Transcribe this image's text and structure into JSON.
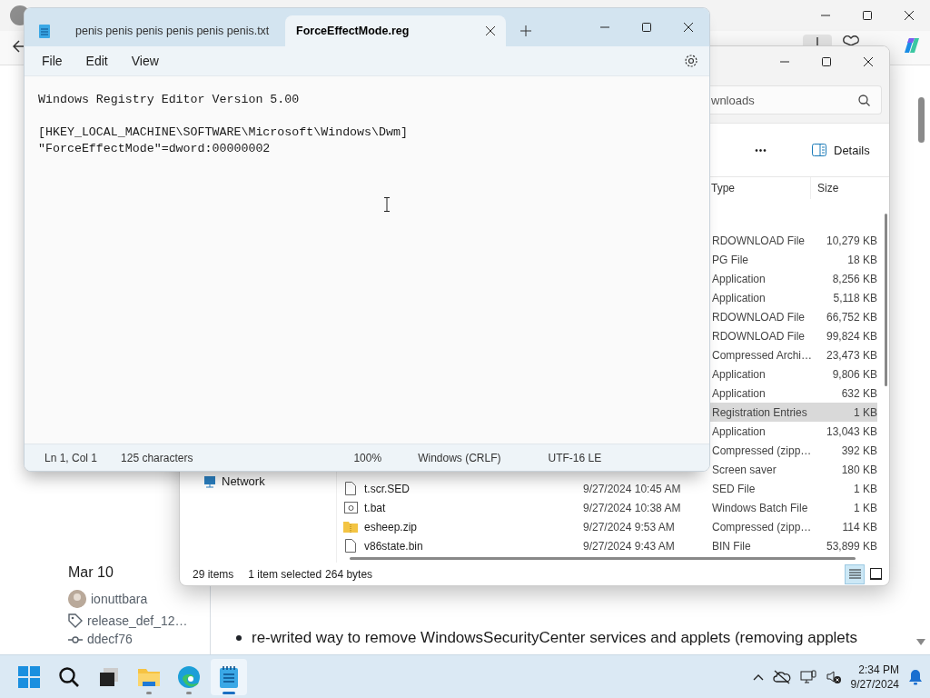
{
  "browser": {
    "page": {
      "date": "Mar 10",
      "author": "ionuttbara",
      "tag": "release_def_12…",
      "commit": "ddecf76",
      "bullets": [
        "re-writed way to remove WindowsSecurityCenter services and applets (removing applets"
      ]
    }
  },
  "explorer": {
    "search": {
      "placeholder": "wnloads"
    },
    "toolbar": {
      "more": "•••",
      "view_button": "Details"
    },
    "columns": [
      "Type",
      "Size"
    ],
    "rows": [
      {
        "type": "RDOWNLOAD File",
        "size": "10,279 KB",
        "selected": false
      },
      {
        "type": "PG File",
        "size": "18 KB",
        "selected": false
      },
      {
        "type": "Application",
        "size": "8,256 KB",
        "selected": false
      },
      {
        "type": "Application",
        "size": "5,118 KB",
        "selected": false
      },
      {
        "type": "RDOWNLOAD File",
        "size": "66,752 KB",
        "selected": false
      },
      {
        "type": "RDOWNLOAD File",
        "size": "99,824 KB",
        "selected": false
      },
      {
        "type": "Compressed Archi…",
        "size": "23,473 KB",
        "selected": false
      },
      {
        "type": "Application",
        "size": "9,806 KB",
        "selected": false
      },
      {
        "type": "Application",
        "size": "632 KB",
        "selected": false
      },
      {
        "type": "Registration Entries",
        "size": "1 KB",
        "selected": true
      },
      {
        "type": "Application",
        "size": "13,043 KB",
        "selected": false
      },
      {
        "type": "Compressed (zipp…",
        "size": "392 KB",
        "selected": false
      },
      {
        "type": "Screen saver",
        "size": "180 KB",
        "selected": false
      },
      {
        "kind": "file",
        "name": "t.scr.SED",
        "date": "9/27/2024 10:45 AM",
        "type": "SED File",
        "size": "1 KB",
        "selected": false
      },
      {
        "kind": "batch",
        "name": "t.bat",
        "date": "9/27/2024 10:38 AM",
        "type": "Windows Batch File",
        "size": "1 KB",
        "selected": false
      },
      {
        "kind": "zip",
        "name": "esheep.zip",
        "date": "9/27/2024 9:53 AM",
        "type": "Compressed (zipp…",
        "size": "114 KB",
        "selected": false
      },
      {
        "kind": "file",
        "name": "v86state.bin",
        "date": "9/27/2024 9:43 AM",
        "type": "BIN File",
        "size": "53,899 KB",
        "selected": false
      }
    ],
    "nav": [
      "Network"
    ],
    "status": {
      "items": "29 items",
      "selection": "1 item selected",
      "size": "264 bytes"
    },
    "view_modes": [
      {
        "kind": "details",
        "selected": true
      },
      {
        "kind": "tiles",
        "selected": false
      }
    ]
  },
  "notepad": {
    "tabs": [
      {
        "label": "penis penis penis penis penis penis.txt",
        "selected": false
      },
      {
        "label": "ForceEffectMode.reg",
        "selected": true
      }
    ],
    "menu": [
      "File",
      "Edit",
      "View"
    ],
    "blocks": [
      [
        "Windows Registry Editor Version 5.00"
      ],
      [
        "[HKEY_LOCAL_MACHINE\\SOFTWARE\\Microsoft\\Windows\\Dwm]",
        "\"ForceEffectMode\"=dword:00000002"
      ]
    ],
    "status": {
      "position": "Ln 1, Col 1",
      "count": "125 characters",
      "zoom": "100%",
      "line_ending": "Windows (CRLF)",
      "encoding": "UTF-16 LE"
    }
  },
  "taskbar": {
    "apps": [
      {
        "kind": "start",
        "running": false,
        "active": false
      },
      {
        "kind": "search",
        "running": false,
        "active": false
      },
      {
        "kind": "taskview",
        "running": false,
        "active": false
      },
      {
        "kind": "explorer",
        "running": true,
        "active": false
      },
      {
        "kind": "edge",
        "running": true,
        "active": false
      },
      {
        "kind": "notepad",
        "running": true,
        "active": true
      }
    ],
    "time": "2:34 PM",
    "date": "9/27/2024"
  }
}
